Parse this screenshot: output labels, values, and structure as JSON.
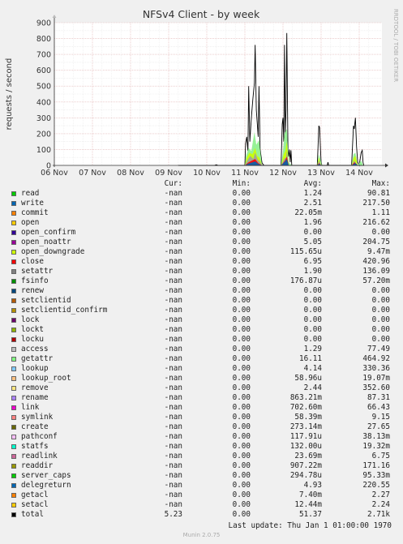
{
  "chart_data": {
    "type": "area",
    "title": "NFSv4 Client - by week",
    "ylabel": "requests / second",
    "side_label": "RRDTOOL / TOBI OETIKER",
    "ylim": [
      0,
      900
    ],
    "yticks": [
      0,
      100,
      200,
      300,
      400,
      500,
      600,
      700,
      800,
      900
    ],
    "xlim": [
      0,
      8.4
    ],
    "x_tick_labels": [
      "06 Nov",
      "07 Nov",
      "08 Nov",
      "09 Nov",
      "10 Nov",
      "11 Nov",
      "12 Nov",
      "13 Nov",
      "14 Nov"
    ],
    "grid": true,
    "series": [
      {
        "name": "total",
        "color": "#000000",
        "points": [
          [
            3.25,
            0
          ],
          [
            4.2,
            0
          ],
          [
            4.25,
            4
          ],
          [
            4.3,
            0
          ],
          [
            5.0,
            0
          ],
          [
            5.02,
            140
          ],
          [
            5.05,
            180
          ],
          [
            5.08,
            90
          ],
          [
            5.1,
            500
          ],
          [
            5.13,
            150
          ],
          [
            5.17,
            300
          ],
          [
            5.21,
            420
          ],
          [
            5.25,
            520
          ],
          [
            5.27,
            760
          ],
          [
            5.3,
            350
          ],
          [
            5.35,
            180
          ],
          [
            5.37,
            500
          ],
          [
            5.4,
            100
          ],
          [
            5.45,
            15
          ],
          [
            5.5,
            0
          ],
          [
            5.95,
            0
          ],
          [
            5.98,
            260
          ],
          [
            6.0,
            300
          ],
          [
            6.02,
            150
          ],
          [
            6.04,
            760
          ],
          [
            6.06,
            200
          ],
          [
            6.08,
            350
          ],
          [
            6.1,
            835
          ],
          [
            6.13,
            100
          ],
          [
            6.15,
            55
          ],
          [
            6.17,
            100
          ],
          [
            6.19,
            20
          ],
          [
            6.21,
            95
          ],
          [
            6.23,
            0
          ],
          [
            6.9,
            0
          ],
          [
            6.92,
            120
          ],
          [
            6.94,
            250
          ],
          [
            6.96,
            240
          ],
          [
            6.98,
            120
          ],
          [
            7.0,
            20
          ],
          [
            7.02,
            0
          ],
          [
            7.16,
            0
          ],
          [
            7.18,
            20
          ],
          [
            7.2,
            0
          ],
          [
            7.8,
            0
          ],
          [
            7.82,
            100
          ],
          [
            7.85,
            250
          ],
          [
            7.87,
            230
          ],
          [
            7.9,
            300
          ],
          [
            7.93,
            120
          ],
          [
            7.96,
            20
          ],
          [
            8.0,
            0
          ],
          [
            8.05,
            80
          ],
          [
            8.08,
            95
          ],
          [
            8.1,
            20
          ],
          [
            8.12,
            0
          ]
        ]
      },
      {
        "name": "getattr",
        "color": "#8cf08c",
        "points": [
          [
            5.0,
            0
          ],
          [
            5.03,
            60
          ],
          [
            5.1,
            110
          ],
          [
            5.17,
            90
          ],
          [
            5.25,
            210
          ],
          [
            5.3,
            130
          ],
          [
            5.37,
            160
          ],
          [
            5.45,
            0
          ],
          [
            5.95,
            0
          ],
          [
            6.0,
            90
          ],
          [
            6.04,
            200
          ],
          [
            6.1,
            230
          ],
          [
            6.15,
            20
          ],
          [
            6.23,
            0
          ],
          [
            6.9,
            0
          ],
          [
            6.94,
            70
          ],
          [
            6.98,
            40
          ],
          [
            7.02,
            0
          ],
          [
            7.8,
            0
          ],
          [
            7.85,
            70
          ],
          [
            7.9,
            80
          ],
          [
            7.96,
            0
          ],
          [
            8.05,
            30
          ],
          [
            8.1,
            0
          ]
        ]
      },
      {
        "name": "open_downgrade",
        "color": "#ccff00",
        "points": [
          [
            5.0,
            0
          ],
          [
            5.05,
            50
          ],
          [
            5.12,
            80
          ],
          [
            5.2,
            70
          ],
          [
            5.27,
            110
          ],
          [
            5.32,
            60
          ],
          [
            5.38,
            50
          ],
          [
            5.45,
            0
          ],
          [
            5.95,
            0
          ],
          [
            6.02,
            70
          ],
          [
            6.06,
            90
          ],
          [
            6.1,
            150
          ],
          [
            6.15,
            0
          ],
          [
            6.9,
            0
          ],
          [
            6.94,
            50
          ],
          [
            7.0,
            0
          ],
          [
            7.8,
            0
          ],
          [
            7.86,
            50
          ],
          [
            7.9,
            60
          ],
          [
            7.96,
            0
          ]
        ]
      },
      {
        "name": "access",
        "color": "#a0a0a0",
        "points": [
          [
            5.0,
            0
          ],
          [
            5.06,
            30
          ],
          [
            5.14,
            60
          ],
          [
            5.22,
            40
          ],
          [
            5.27,
            80
          ],
          [
            5.33,
            40
          ],
          [
            5.4,
            20
          ],
          [
            5.45,
            0
          ],
          [
            5.95,
            0
          ],
          [
            6.03,
            40
          ],
          [
            6.08,
            50
          ],
          [
            6.1,
            90
          ],
          [
            6.15,
            0
          ],
          [
            6.9,
            0
          ],
          [
            6.95,
            30
          ],
          [
            7.0,
            0
          ],
          [
            7.8,
            0
          ],
          [
            7.87,
            30
          ],
          [
            7.96,
            0
          ]
        ]
      },
      {
        "name": "close",
        "color": "#ff0000",
        "points": [
          [
            5.0,
            0
          ],
          [
            5.1,
            20
          ],
          [
            5.27,
            40
          ],
          [
            5.35,
            15
          ],
          [
            5.45,
            0
          ],
          [
            5.95,
            0
          ],
          [
            6.05,
            30
          ],
          [
            6.1,
            55
          ],
          [
            6.15,
            0
          ],
          [
            6.9,
            0
          ],
          [
            6.95,
            15
          ],
          [
            7.0,
            0
          ],
          [
            7.8,
            0
          ],
          [
            7.88,
            20
          ],
          [
            7.96,
            0
          ]
        ]
      },
      {
        "name": "write",
        "color": "#0066b3",
        "points": [
          [
            5.0,
            0
          ],
          [
            5.1,
            12
          ],
          [
            5.27,
            25
          ],
          [
            5.35,
            10
          ],
          [
            5.45,
            0
          ],
          [
            5.95,
            0
          ],
          [
            6.05,
            25
          ],
          [
            6.1,
            40
          ],
          [
            6.15,
            0
          ],
          [
            6.9,
            0
          ],
          [
            6.95,
            10
          ],
          [
            7.0,
            0
          ],
          [
            7.8,
            0
          ],
          [
            7.9,
            15
          ],
          [
            7.96,
            0
          ]
        ]
      }
    ],
    "legend_headers": {
      "cur": "Cur:",
      "min": "Min:",
      "avg": "Avg:",
      "max": "Max:"
    },
    "legend": [
      {
        "name": "read",
        "color": "#00cc00",
        "cur": "-nan",
        "min": "0.00",
        "avg": "1.24",
        "max": "90.81"
      },
      {
        "name": "write",
        "color": "#0066b3",
        "cur": "-nan",
        "min": "0.00",
        "avg": "2.51",
        "max": "217.50"
      },
      {
        "name": "commit",
        "color": "#ff8000",
        "cur": "-nan",
        "min": "0.00",
        "avg": "22.05m",
        "max": "1.11"
      },
      {
        "name": "open",
        "color": "#ffcc00",
        "cur": "-nan",
        "min": "0.00",
        "avg": "1.96",
        "max": "216.62"
      },
      {
        "name": "open_confirm",
        "color": "#330099",
        "cur": "-nan",
        "min": "0.00",
        "avg": "0.00",
        "max": "0.00"
      },
      {
        "name": "open_noattr",
        "color": "#990099",
        "cur": "-nan",
        "min": "0.00",
        "avg": "5.05",
        "max": "204.75"
      },
      {
        "name": "open_downgrade",
        "color": "#ccff00",
        "cur": "-nan",
        "min": "0.00",
        "avg": "115.65u",
        "max": "9.47m"
      },
      {
        "name": "close",
        "color": "#ff0000",
        "cur": "-nan",
        "min": "0.00",
        "avg": "6.95",
        "max": "420.96"
      },
      {
        "name": "setattr",
        "color": "#808080",
        "cur": "-nan",
        "min": "0.00",
        "avg": "1.90",
        "max": "136.09"
      },
      {
        "name": "fsinfo",
        "color": "#008f00",
        "cur": "-nan",
        "min": "0.00",
        "avg": "176.87u",
        "max": "57.20m"
      },
      {
        "name": "renew",
        "color": "#00487d",
        "cur": "-nan",
        "min": "0.00",
        "avg": "0.00",
        "max": "0.00"
      },
      {
        "name": "setclientid",
        "color": "#b35a00",
        "cur": "-nan",
        "min": "0.00",
        "avg": "0.00",
        "max": "0.00"
      },
      {
        "name": "setclientid_confirm",
        "color": "#b38f00",
        "cur": "-nan",
        "min": "0.00",
        "avg": "0.00",
        "max": "0.00"
      },
      {
        "name": "lock",
        "color": "#6b006b",
        "cur": "-nan",
        "min": "0.00",
        "avg": "0.00",
        "max": "0.00"
      },
      {
        "name": "lockt",
        "color": "#8fb300",
        "cur": "-nan",
        "min": "0.00",
        "avg": "0.00",
        "max": "0.00"
      },
      {
        "name": "locku",
        "color": "#b30000",
        "cur": "-nan",
        "min": "0.00",
        "avg": "0.00",
        "max": "0.00"
      },
      {
        "name": "access",
        "color": "#bebebe",
        "cur": "-nan",
        "min": "0.00",
        "avg": "1.29",
        "max": "77.49"
      },
      {
        "name": "getattr",
        "color": "#80ff80",
        "cur": "-nan",
        "min": "0.00",
        "avg": "16.11",
        "max": "464.92"
      },
      {
        "name": "lookup",
        "color": "#80c9ff",
        "cur": "-nan",
        "min": "0.00",
        "avg": "4.14",
        "max": "330.36"
      },
      {
        "name": "lookup_root",
        "color": "#ffc080",
        "cur": "-nan",
        "min": "0.00",
        "avg": "58.96u",
        "max": "19.07m"
      },
      {
        "name": "remove",
        "color": "#ffe680",
        "cur": "-nan",
        "min": "0.00",
        "avg": "2.44",
        "max": "352.60"
      },
      {
        "name": "rename",
        "color": "#aa80ff",
        "cur": "-nan",
        "min": "0.00",
        "avg": "863.21m",
        "max": "87.31"
      },
      {
        "name": "link",
        "color": "#ee00cc",
        "cur": "-nan",
        "min": "0.00",
        "avg": "702.60m",
        "max": "66.43"
      },
      {
        "name": "symlink",
        "color": "#ff8080",
        "cur": "-nan",
        "min": "0.00",
        "avg": "58.39m",
        "max": "9.15"
      },
      {
        "name": "create",
        "color": "#666600",
        "cur": "-nan",
        "min": "0.00",
        "avg": "273.14m",
        "max": "27.65"
      },
      {
        "name": "pathconf",
        "color": "#ffbfff",
        "cur": "-nan",
        "min": "0.00",
        "avg": "117.91u",
        "max": "38.13m"
      },
      {
        "name": "statfs",
        "color": "#00ffcc",
        "cur": "-nan",
        "min": "0.00",
        "avg": "132.00u",
        "max": "19.32m"
      },
      {
        "name": "readlink",
        "color": "#cc6699",
        "cur": "-nan",
        "min": "0.00",
        "avg": "23.69m",
        "max": "6.75"
      },
      {
        "name": "readdir",
        "color": "#999900",
        "cur": "-nan",
        "min": "0.00",
        "avg": "907.22m",
        "max": "171.16"
      },
      {
        "name": "server_caps",
        "color": "#00cc00",
        "cur": "-nan",
        "min": "0.00",
        "avg": "294.78u",
        "max": "95.33m"
      },
      {
        "name": "delegreturn",
        "color": "#0066b3",
        "cur": "-nan",
        "min": "0.00",
        "avg": "4.93",
        "max": "220.55"
      },
      {
        "name": "getacl",
        "color": "#ff8000",
        "cur": "-nan",
        "min": "0.00",
        "avg": "7.40m",
        "max": "2.27"
      },
      {
        "name": "setacl",
        "color": "#ffcc00",
        "cur": "-nan",
        "min": "0.00",
        "avg": "12.44m",
        "max": "2.24"
      },
      {
        "name": "total",
        "color": "#000000",
        "cur": "5.23",
        "min": "0.00",
        "avg": "51.37",
        "max": "2.71k"
      }
    ]
  },
  "footer": {
    "last_update": "Last update: Thu Jan  1 01:00:00 1970",
    "munin_version": "Munin 2.0.75"
  }
}
